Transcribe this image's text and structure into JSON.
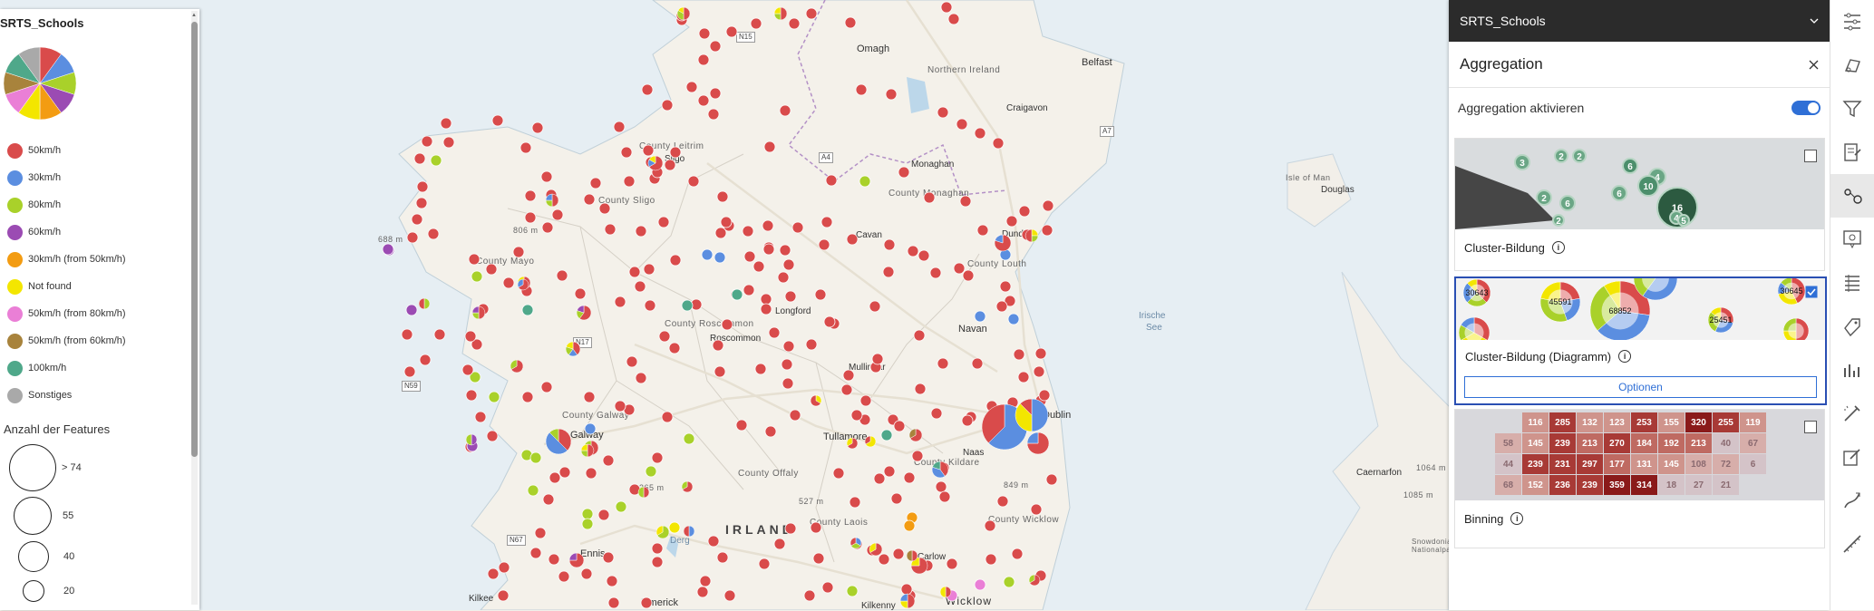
{
  "map": {
    "country_label": "IRLAND",
    "sea_label_1": "Irische",
    "sea_label_2": "See",
    "cities": [
      {
        "name": "Omagh"
      },
      {
        "name": "Belfast"
      },
      {
        "name": "Northern Ireland"
      },
      {
        "name": "Craigavon"
      },
      {
        "name": "Monaghan"
      },
      {
        "name": "Sligo"
      },
      {
        "name": "Longford"
      },
      {
        "name": "Roscommon"
      },
      {
        "name": "Mullingar"
      },
      {
        "name": "Navan"
      },
      {
        "name": "Tullamore"
      },
      {
        "name": "Galway"
      },
      {
        "name": "Naas"
      },
      {
        "name": "Ennis"
      },
      {
        "name": "Carlow"
      },
      {
        "name": "Limerick"
      },
      {
        "name": "Kilkenny"
      },
      {
        "name": "Wicklow"
      },
      {
        "name": "Kilkee"
      },
      {
        "name": "Douglas"
      },
      {
        "name": "Isle of Man"
      },
      {
        "name": "Caernarfon"
      },
      {
        "name": "Dundalk"
      },
      {
        "name": "Cavan"
      },
      {
        "name": "Dublin"
      },
      {
        "name": "Derg"
      }
    ],
    "counties": [
      "County Leitrim",
      "County Sligo",
      "County Mayo",
      "County Roscommon",
      "County Galway",
      "County Offaly",
      "County Laois",
      "County Kildare",
      "County Wicklow",
      "County Monaghan",
      "County Louth"
    ],
    "peaks": [
      "806 m",
      "688 m",
      "365 m",
      "527 m",
      "849 m",
      "1064 m",
      "1085 m"
    ],
    "roads": [
      "N15",
      "A4",
      "A7",
      "N17",
      "N59",
      "N67"
    ],
    "national_park": "Snowdonia-\nNationalpark"
  },
  "legend": {
    "layer_title": "SRTS_Schools",
    "items": [
      {
        "label": "50km/h",
        "color": "#d94b4b"
      },
      {
        "label": "30km/h",
        "color": "#5b8ee0"
      },
      {
        "label": "80km/h",
        "color": "#a9d12a"
      },
      {
        "label": "60km/h",
        "color": "#9b4bb3"
      },
      {
        "label": "30km/h (from 50km/h)",
        "color": "#f39c12"
      },
      {
        "label": "Not found",
        "color": "#f3e600"
      },
      {
        "label": "50km/h (from 80km/h)",
        "color": "#ea7fd6"
      },
      {
        "label": "50km/h (from 60km/h)",
        "color": "#a8833c"
      },
      {
        "label": "100km/h",
        "color": "#4fa88a"
      },
      {
        "label": "Sonstiges",
        "color": "#a9a9a9"
      }
    ],
    "size_title": "Anzahl der Features",
    "sizes": [
      {
        "label": "> 74"
      },
      {
        "label": "55"
      },
      {
        "label": "40"
      },
      {
        "label": "20"
      }
    ]
  },
  "panel": {
    "layer_name": "SRTS_Schools",
    "title": "Aggregation",
    "toggle_label": "Aggregation aktivieren",
    "toggle_on": true,
    "options": [
      {
        "label": "Cluster-Bildung",
        "selected": false,
        "cluster_counts": [
          "3",
          "2",
          "2",
          "6",
          "4",
          "10",
          "6",
          "2",
          "6",
          "16",
          "4",
          "5",
          "2"
        ]
      },
      {
        "label": "Cluster-Bildung (Diagramm)",
        "selected": true,
        "button": "Optionen",
        "cluster_counts": [
          "30643",
          "45591",
          "68852",
          "30645",
          "25451"
        ]
      },
      {
        "label": "Binning",
        "selected": false,
        "bin_values": [
          [
            "",
            "116",
            "285",
            "132",
            "123",
            "253",
            "155",
            "320",
            "255",
            "119"
          ],
          [
            "58",
            "145",
            "239",
            "213",
            "270",
            "184",
            "192",
            "213",
            "40",
            "67"
          ],
          [
            "44",
            "239",
            "231",
            "297",
            "177",
            "131",
            "145",
            "108",
            "72",
            "6"
          ],
          [
            "68",
            "152",
            "236",
            "239",
            "359",
            "314",
            "18",
            "27",
            "21",
            ""
          ]
        ]
      }
    ]
  },
  "toolbar": {
    "tools": [
      "properties-icon",
      "styles-icon",
      "filter-icon",
      "forms-icon",
      "aggregation-icon",
      "popup-icon",
      "fields-icon",
      "labels-icon",
      "charts-icon",
      "effects-icon",
      "edit-icon",
      "sketch-icon",
      "measure-icon"
    ],
    "active": "aggregation-icon"
  }
}
